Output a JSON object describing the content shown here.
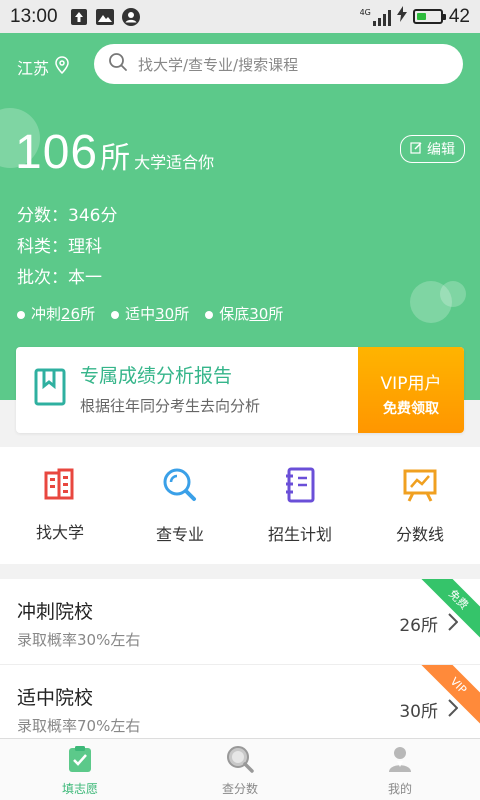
{
  "status_bar": {
    "time": "13:00",
    "network": "4G",
    "battery": "42",
    "battery_level": 0.42
  },
  "header": {
    "location": "江苏",
    "search_placeholder": "找大学/查专业/搜索课程"
  },
  "hero": {
    "count": "106",
    "count_unit": "所",
    "count_suffix": "大学适合你",
    "edit_label": "编辑",
    "score": "分数：346分",
    "subject": "科类：理科",
    "batch": "批次：本一",
    "tiers": [
      {
        "prefix": "冲刺",
        "num": "26",
        "unit": "所"
      },
      {
        "prefix": "适中",
        "num": "30",
        "unit": "所"
      },
      {
        "prefix": "保底",
        "num": "30",
        "unit": "所"
      }
    ]
  },
  "report": {
    "title": "专属成绩分析报告",
    "subtitle": "根据往年同分考生去向分析",
    "vip_line1": "VIP用户",
    "vip_line2": "免费领取"
  },
  "quick_nav": [
    {
      "label": "找大学",
      "icon": "building-icon",
      "color": "#e8473f"
    },
    {
      "label": "查专业",
      "icon": "search-icon",
      "color": "#3aa0e8"
    },
    {
      "label": "招生计划",
      "icon": "notebook-icon",
      "color": "#6a4fd8"
    },
    {
      "label": "分数线",
      "icon": "chart-board-icon",
      "color": "#f0a020"
    }
  ],
  "list": [
    {
      "title": "冲刺院校",
      "desc": "录取概率30%左右",
      "count": "26所",
      "badge": "免费"
    },
    {
      "title": "适中院校",
      "desc": "录取概率70%左右",
      "count": "30所",
      "badge": "VIP"
    }
  ],
  "bottom_nav": [
    {
      "label": "填志愿",
      "icon": "clipboard-check-icon",
      "active": true
    },
    {
      "label": "查分数",
      "icon": "magnifier-icon",
      "active": false
    },
    {
      "label": "我的",
      "icon": "user-icon",
      "active": false
    }
  ],
  "colors": {
    "hero_green": "#5cc98a",
    "accent_green": "#35b58a",
    "vip_orange": "#ff9600"
  }
}
